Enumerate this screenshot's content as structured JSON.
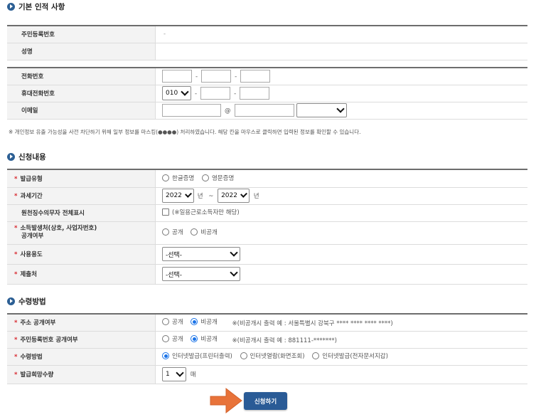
{
  "sections": {
    "basic": "기본 인적 사항",
    "request": "신청내용",
    "receipt": "수령방법"
  },
  "basic": {
    "resident_no_label": "주민등록번호",
    "resident_no_value": "-",
    "name_label": "성명",
    "phone_label": "전화번호",
    "mobile_label": "휴대전화번호",
    "mobile_prefix": "010",
    "email_label": "이메일",
    "at": "@",
    "dash": "-"
  },
  "notice": "※ 개인정보 유출 가능성을 사전 차단하기 위해 일부 정보를 마스킹(●●●●) 처리하였습니다. 해당 칸을 마우스로 클릭하면 입력된 정보를 확인할 수 있습니다.",
  "request": {
    "issue_type_label": "발급유형",
    "issue_type_options": [
      "한글증명",
      "영문증명"
    ],
    "tax_period_label": "과세기간",
    "year_from": "2022",
    "year_to": "2022",
    "year_unit": "년",
    "tilde": "~",
    "withholding_label": "원천징수의무자 전체표시",
    "withholding_note": "(※일용근로소득자만 해당)",
    "income_payer_label_1": "소득발생처(상호, 사업자번호)",
    "income_payer_label_2": "공개여부",
    "disclose_options": [
      "공개",
      "비공개"
    ],
    "purpose_label": "사용용도",
    "purpose_value": "-선택-",
    "submit_to_label": "제출처",
    "submit_to_value": "-선택-"
  },
  "receipt": {
    "address_label": "주소 공개여부",
    "address_options": [
      "공개",
      "비공개"
    ],
    "address_note": "※(비공개시 출력 예 : 서울특별시 강북구 **** **** **** ****)",
    "resident_disclose_label": "주민등록번호 공개여부",
    "resident_options": [
      "공개",
      "비공개"
    ],
    "resident_note": "※(비공개시 출력 예 : 881111-*******)",
    "method_label": "수령방법",
    "method_options": [
      "인터넷발급(프린터출력)",
      "인터넷열람(화면조회)",
      "인터넷발급(전자문서지갑)"
    ],
    "copies_label": "발급희망수량",
    "copies_value": "1",
    "copies_unit": "매"
  },
  "submit_label": "신청하기",
  "colors": {
    "accent": "#2a5b96",
    "required": "#d8282f",
    "arrow": "#e8733a"
  }
}
